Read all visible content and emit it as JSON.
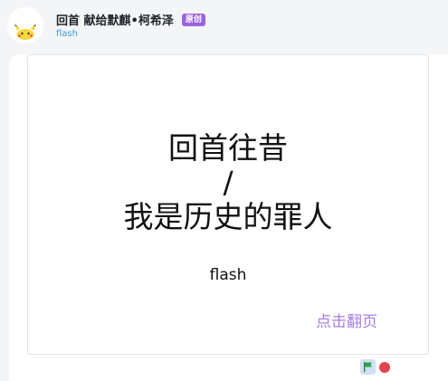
{
  "header": {
    "title": "回首 献给默麒•柯希泽",
    "badge": "原创",
    "subtitle": "flash"
  },
  "stage": {
    "line1": "回首往昔",
    "line2": "/",
    "line3": "我是历史的罪人",
    "author": "flash",
    "page_turn": "点击翻页"
  },
  "colors": {
    "badge_bg": "#9b63e0",
    "subtitle": "#3a9ad9",
    "page_turn": "#a77be0",
    "flag": "#2aa44a",
    "stop": "#e0454d"
  },
  "icons": {
    "avatar": "pikachu-avatar-icon",
    "start": "green-flag-icon",
    "stop": "stop-icon"
  }
}
